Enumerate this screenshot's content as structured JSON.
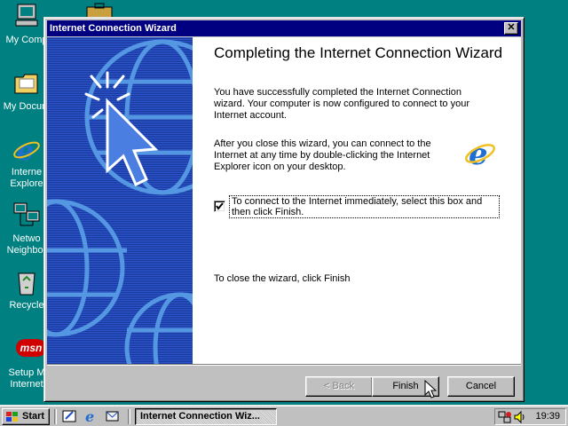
{
  "desktop": {
    "icons": [
      {
        "name": "my-computer",
        "label": "My Comp"
      },
      {
        "name": "my-documents",
        "label": "My Docum"
      },
      {
        "name": "internet-explorer",
        "label_line1": "Interne",
        "label_line2": "Explore"
      },
      {
        "name": "network-neighborhood",
        "label_line1": "Netwo",
        "label_line2": "Neighbor"
      },
      {
        "name": "recycle-bin",
        "label": "Recycle"
      },
      {
        "name": "setup-msn",
        "label_line1": "Setup M",
        "label_line2": "Internet",
        "badge": "msn"
      }
    ]
  },
  "window": {
    "title": "Internet Connection Wizard",
    "close_glyph": "✕",
    "heading": "Completing the Internet Connection Wizard",
    "paragraph1": "You have successfully completed the Internet Connection wizard. Your computer is now configured to connect to your Internet account.",
    "paragraph2": "After you close this wizard, you can connect to the Internet at any time by double-clicking the Internet Explorer icon on your desktop.",
    "checkbox": {
      "checked": true,
      "label": "To connect to the Internet immediately, select this box and then click Finish."
    },
    "paragraph3": "To close the wizard, click Finish",
    "buttons": {
      "back": "< Back",
      "finish": "Finish",
      "cancel": "Cancel"
    }
  },
  "taskbar": {
    "start_label": "Start",
    "task_label": "Internet Connection Wiz...",
    "clock": "19:39"
  },
  "colors": {
    "desktop": "#008080",
    "titlebar": "#000080",
    "side_art": "#1a3ca8"
  }
}
